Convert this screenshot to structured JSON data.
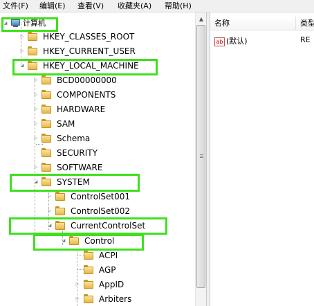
{
  "menu": [
    "文件(F)",
    "编辑(E)",
    "查看(V)",
    "收藏夹(A)",
    "帮助(H)"
  ],
  "tree": {
    "root": "计算机",
    "items": [
      {
        "label": "HKEY_CLASSES_ROOT",
        "state": "collapsed"
      },
      {
        "label": "HKEY_CURRENT_USER",
        "state": "collapsed"
      },
      {
        "label": "HKEY_LOCAL_MACHINE",
        "state": "expanded"
      },
      {
        "label": "BCD00000000",
        "state": "collapsed"
      },
      {
        "label": "COMPONENTS",
        "state": "collapsed"
      },
      {
        "label": "HARDWARE",
        "state": "collapsed"
      },
      {
        "label": "SAM",
        "state": "collapsed"
      },
      {
        "label": "Schema",
        "state": "collapsed"
      },
      {
        "label": "SECURITY",
        "state": "leaf"
      },
      {
        "label": "SOFTWARE",
        "state": "collapsed"
      },
      {
        "label": "SYSTEM",
        "state": "expanded"
      },
      {
        "label": "ControlSet001",
        "state": "collapsed"
      },
      {
        "label": "ControlSet002",
        "state": "collapsed"
      },
      {
        "label": "CurrentControlSet",
        "state": "expanded"
      },
      {
        "label": "Control",
        "state": "expanded"
      },
      {
        "label": "ACPI",
        "state": "leaf"
      },
      {
        "label": "AGP",
        "state": "leaf"
      },
      {
        "label": "AppID",
        "state": "collapsed"
      },
      {
        "label": "Arbiters",
        "state": "collapsed"
      }
    ],
    "highlighted": [
      "计算机",
      "HKEY_LOCAL_MACHINE",
      "SYSTEM",
      "CurrentControlSet",
      "Control"
    ],
    "highlight_color": "#3fe01c"
  },
  "list": {
    "columns": [
      "名称",
      "类型"
    ],
    "rows": [
      {
        "name": "(默认)",
        "type": "RE",
        "icon": "ab"
      }
    ]
  },
  "folder_color": "#e6b84a"
}
